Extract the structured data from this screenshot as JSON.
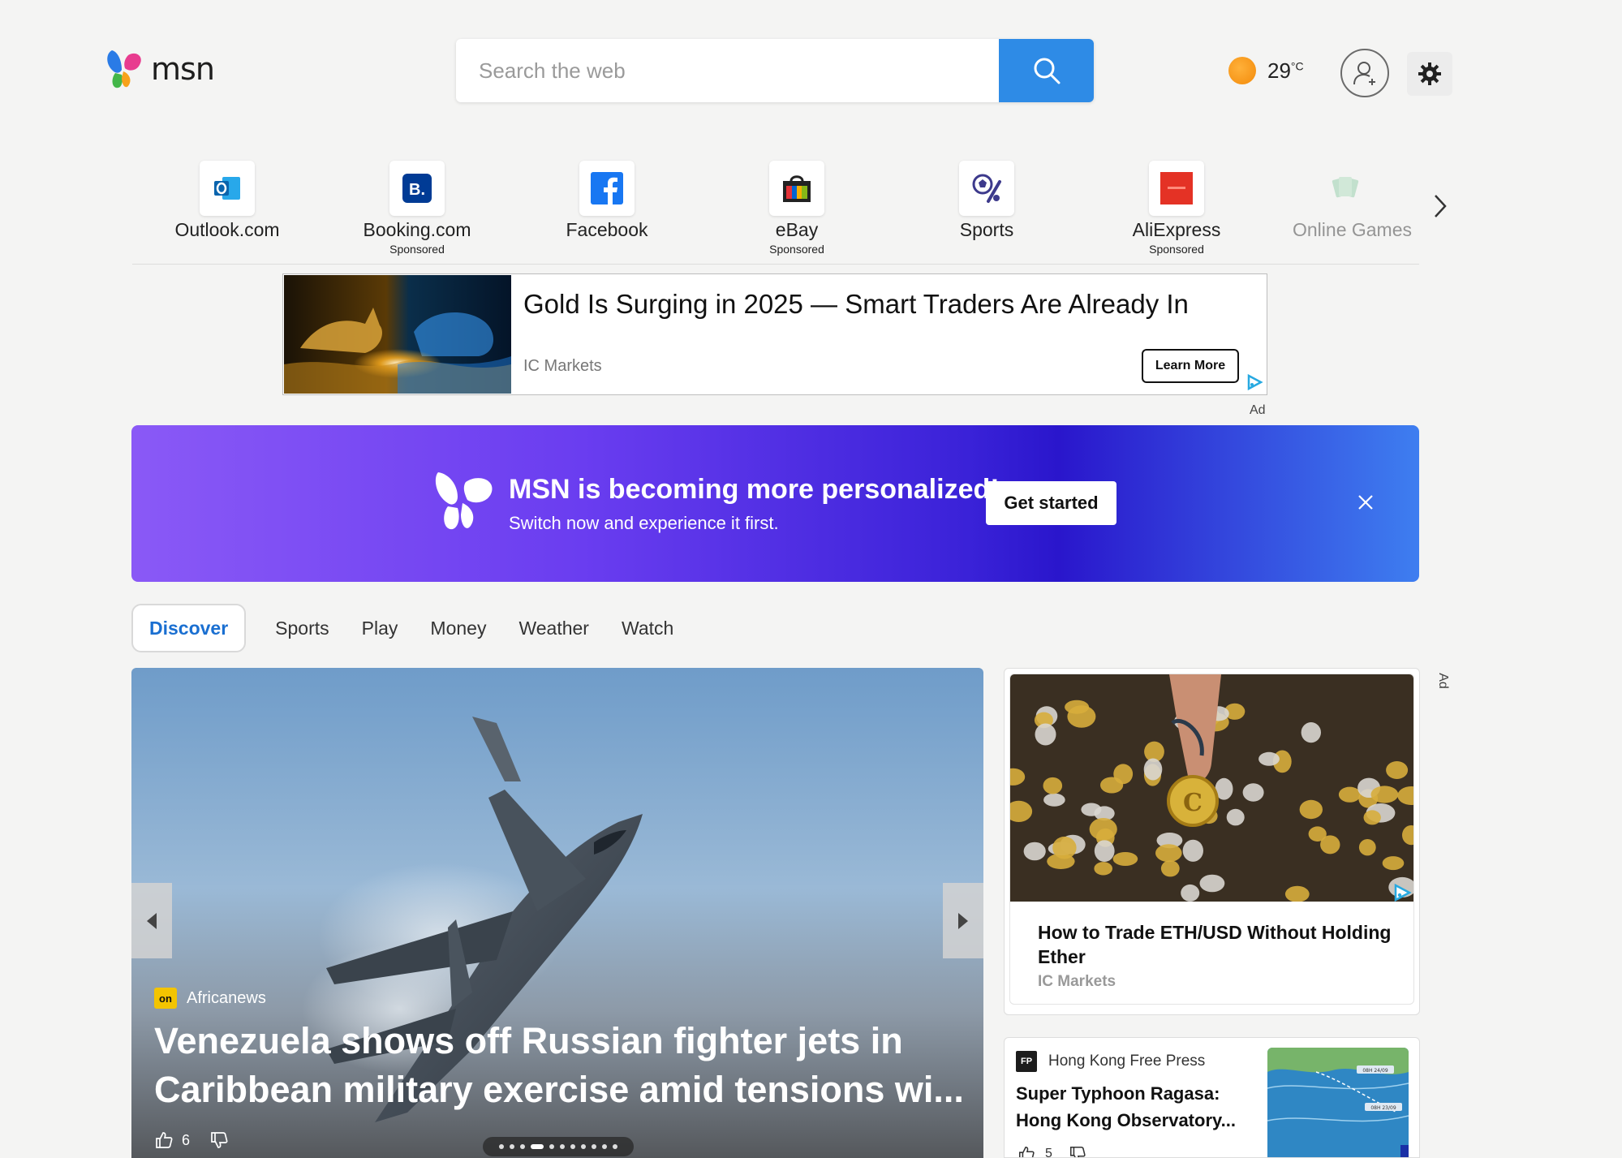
{
  "header": {
    "logo_text": "msn",
    "search_placeholder": "Search the web",
    "weather": {
      "temperature": "29",
      "unit": "°C",
      "condition_icon": "sun-icon"
    },
    "profile_icon": "user-add-icon",
    "settings_icon": "gear-icon"
  },
  "quick_links": [
    {
      "label": "Outlook.com",
      "sub": "",
      "icon": "outlook-icon"
    },
    {
      "label": "Booking.com",
      "sub": "Sponsored",
      "icon": "booking-icon"
    },
    {
      "label": "Facebook",
      "sub": "",
      "icon": "facebook-icon"
    },
    {
      "label": "eBay",
      "sub": "Sponsored",
      "icon": "ebay-bag-icon"
    },
    {
      "label": "Sports",
      "sub": "",
      "icon": "sports-icon"
    },
    {
      "label": "AliExpress",
      "sub": "Sponsored",
      "icon": "aliexpress-icon"
    },
    {
      "label": "Online Games",
      "sub": "",
      "icon": "cards-icon"
    }
  ],
  "ad_banner": {
    "title": "Gold Is Surging in 2025 — Smart Traders Are Already In",
    "advertiser": "IC Markets",
    "cta": "Learn More",
    "ad_label": "Ad"
  },
  "promo": {
    "title": "MSN is becoming more personalized!",
    "subtitle": "Switch now and experience it first.",
    "cta": "Get started"
  },
  "tabs": [
    {
      "label": "Discover",
      "active": true
    },
    {
      "label": "Sports",
      "active": false
    },
    {
      "label": "Play",
      "active": false
    },
    {
      "label": "Money",
      "active": false
    },
    {
      "label": "Weather",
      "active": false
    },
    {
      "label": "Watch",
      "active": false
    }
  ],
  "hero": {
    "source": "Africanews",
    "source_badge": "on",
    "title": "Venezuela shows off Russian fighter jets in Caribbean military exercise amid tensions wi...",
    "likes": "6",
    "carousel_total": 11,
    "carousel_active": 3
  },
  "right_ad": {
    "title": "How to Trade ETH/USD Without Holding Ether",
    "advertiser": "IC Markets",
    "side_label": "Ad"
  },
  "news_card": {
    "source": "Hong Kong Free Press",
    "source_badge": "FP",
    "title": "Super Typhoon Ragasa: Hong Kong Observatory...",
    "likes": "5",
    "map_labels": [
      "08H 24/09",
      "08H 23/09"
    ]
  },
  "colors": {
    "accent": "#2e8be6",
    "active_tab": "#1a6fd1",
    "promo_start": "#8a59f6",
    "promo_end": "#3e7ef0"
  }
}
